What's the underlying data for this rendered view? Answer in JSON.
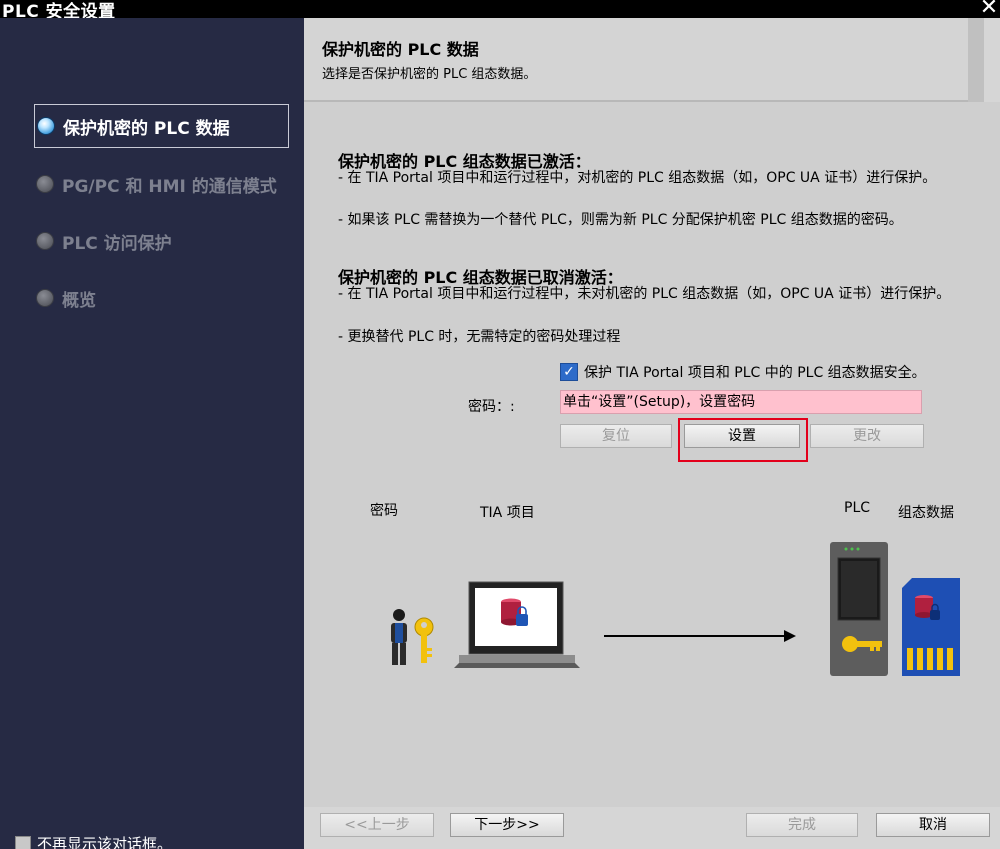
{
  "window": {
    "title": "PLC 安全设置",
    "close_glyph": "✕"
  },
  "sidebar": {
    "items": [
      {
        "label": "保护机密的 PLC 数据",
        "active": true
      },
      {
        "label": "PG/PC 和 HMI 的通信模式",
        "active": false
      },
      {
        "label": "PLC 访问保护",
        "active": false
      },
      {
        "label": "概览",
        "active": false
      }
    ],
    "dont_show_label": "不再显示该对话框。"
  },
  "header": {
    "title": "保护机密的 PLC 数据",
    "subtitle": "选择是否保护机密的 PLC 组态数据。"
  },
  "content": {
    "activated_title": "保护机密的 PLC 组态数据已激活：",
    "activated_bullet_1": "- 在 TIA Portal 项目中和运行过程中，对机密的 PLC 组态数据（如，OPC UA 证书）进行保护。",
    "activated_bullet_2": "- 如果该 PLC 需替换为一个替代 PLC，则需为新 PLC 分配保护机密 PLC 组态数据的密码。",
    "deactivated_title": "保护机密的 PLC 组态数据已取消激活：",
    "deactivated_bullet_1": "- 在 TIA Portal 项目中和运行过程中，未对机密的 PLC 组态数据（如，OPC UA 证书）进行保护。",
    "deactivated_bullet_2": "- 更换替代 PLC 时，无需特定的密码处理过程",
    "protect_checkbox_label": "保护 TIA Portal 项目和 PLC 中的 PLC 组态数据安全。",
    "protect_checked": true,
    "password_label": "密码：:",
    "password_value": "单击“设置”(Setup)，设置密码",
    "reset_button": "复位",
    "setup_button": "设置",
    "change_button": "更改"
  },
  "diagram": {
    "label_password": "密码",
    "label_tia_project": "TIA 项目",
    "label_plc": "PLC",
    "label_config_data": "组态数据"
  },
  "footer": {
    "back_button": "<<上一步",
    "next_button": "下一步>>",
    "finish_button": "完成",
    "cancel_button": "取消"
  },
  "colors": {
    "sidebar_bg": "#262a44",
    "password_field_bg": "#ffc1ce",
    "highlight_border": "#e3001b",
    "checkbox_blue": "#2d6bc9"
  }
}
